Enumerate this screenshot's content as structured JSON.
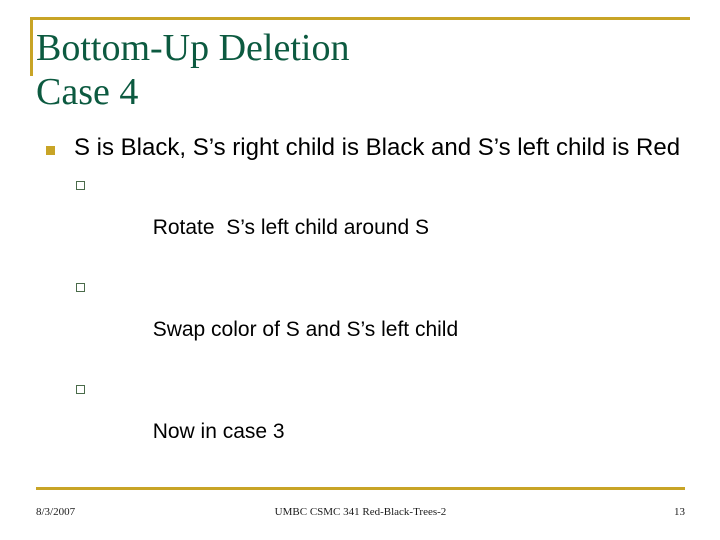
{
  "slide": {
    "title_lines": [
      "Bottom-Up Deletion",
      "Case 4"
    ],
    "bullets": [
      {
        "level": 1,
        "marker": "filled-square-bullet",
        "text": "S is Black, S’s right child is Black and S’s left child is Red"
      }
    ],
    "sub_bullets": [
      {
        "level": 2,
        "marker": "hollow-square-bullet",
        "text": "Rotate  S’s left child around S"
      },
      {
        "level": 2,
        "marker": "hollow-square-bullet",
        "text": "Swap color of S and S’s left child"
      },
      {
        "level": 2,
        "marker": "hollow-square-bullet",
        "text": "Now in case 3"
      }
    ],
    "footer": {
      "date": "8/3/2007",
      "center": "UMBC CSMC 341 Red-Black-Trees-2",
      "page_number": "13"
    },
    "colors": {
      "accent_gold": "#c8a426",
      "title_green": "#0c5a40",
      "body_black": "#000000",
      "sub_bullet_green": "#4a6b4a",
      "background": "#ffffff"
    }
  }
}
